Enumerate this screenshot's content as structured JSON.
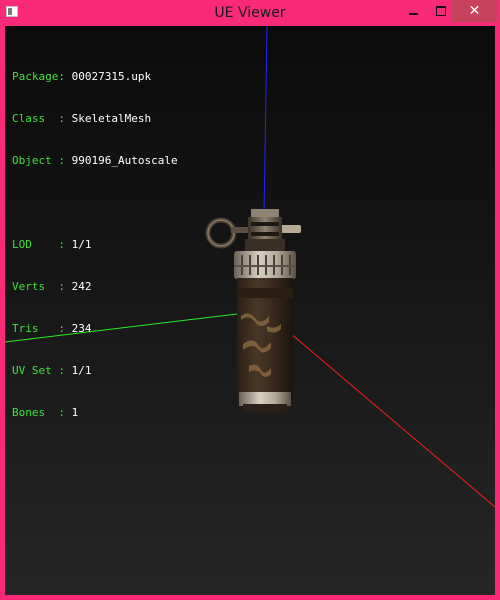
{
  "window": {
    "title": "UE Viewer"
  },
  "info": {
    "package_label": "Package:",
    "package_value": "00027315.upk",
    "class_label": "Class  :",
    "class_value": "SkeletalMesh",
    "object_label": "Object :",
    "object_value": "990196_Autoscale",
    "lod_label": "LOD    :",
    "lod_value": "1/1",
    "verts_label": "Verts  :",
    "verts_value": "242",
    "tris_label": "Tris   :",
    "tris_value": "234",
    "uvset_label": "UV Set :",
    "uvset_value": "1/1",
    "bones_label": "Bones  :",
    "bones_value": "1"
  },
  "colors": {
    "frame": "#fa2a78",
    "axis_x": "#ff1a1a",
    "axis_y": "#2222ff",
    "axis_z": "#22ee22",
    "label": "#3ee03e"
  },
  "icons": [
    "app-icon",
    "minimize-icon",
    "maximize-icon",
    "close-icon"
  ]
}
